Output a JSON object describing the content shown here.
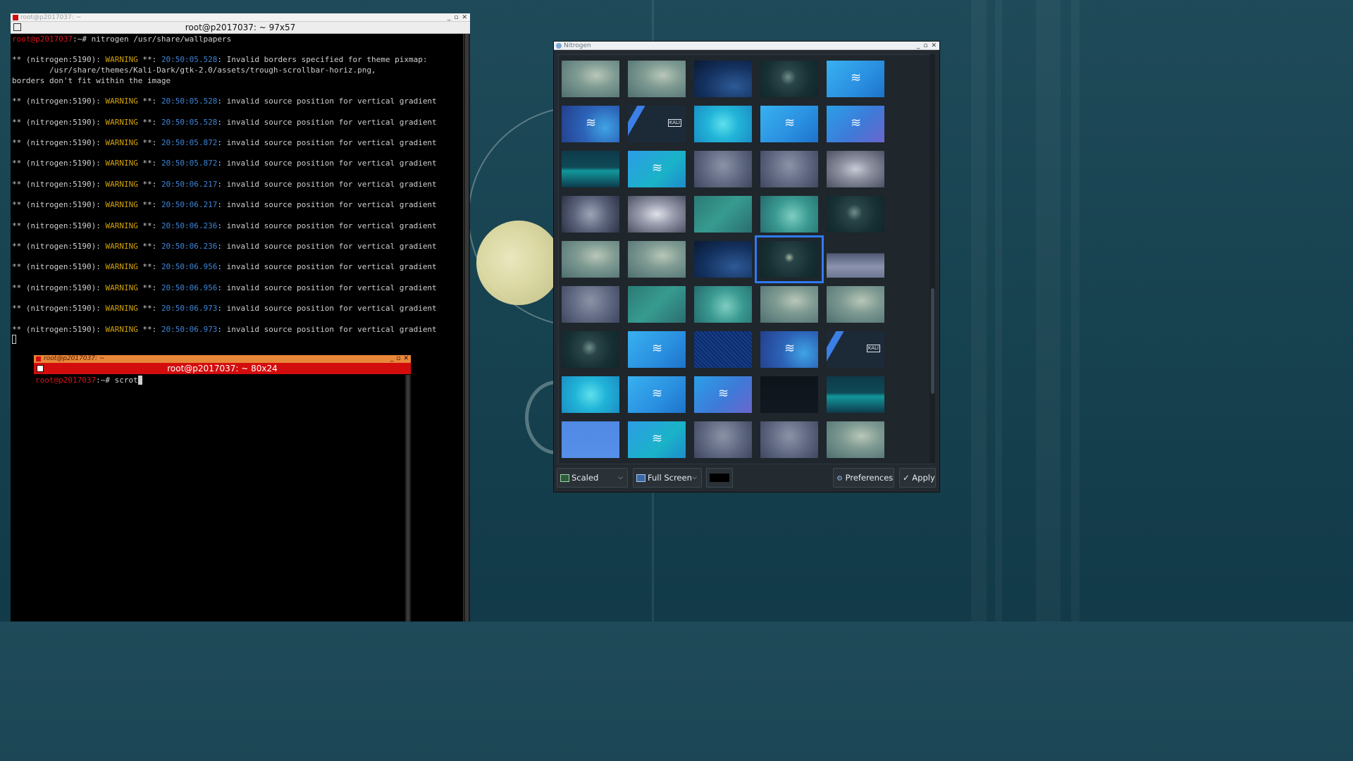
{
  "terminal1": {
    "title": "root@p2017037: ~",
    "header": "root@p2017037: ~ 97x57",
    "prompt_user": "root@p2017037",
    "prompt_path": ":~# ",
    "command": "nitrogen /usr/share/wallpapers",
    "first_warning": {
      "prefix": "** (nitrogen:5190): ",
      "level": "WARNING",
      "stars": " **: ",
      "time": "20:50:05.528",
      "message": ": Invalid borders specified for theme pixmap:",
      "line2": "        /usr/share/themes/Kali-Dark/gtk-2.0/assets/trough-scrollbar-horiz.png,",
      "line3": "borders don't fit within the image"
    },
    "warning_prefix": "** (nitrogen:5190): ",
    "warning_level": "WARNING",
    "warning_stars": " **: ",
    "warning_message": ": invalid source position for vertical gradient",
    "warning_times": [
      "20:50:05.528",
      "20:50:05.528",
      "20:50:05.872",
      "20:50:05.872",
      "20:50:06.217",
      "20:50:06.217",
      "20:50:06.236",
      "20:50:06.236",
      "20:50:06.956",
      "20:50:06.956",
      "20:50:06.973",
      "20:50:06.973"
    ]
  },
  "terminal2": {
    "title": "root@p2017037: ~",
    "header": "root@p2017037: ~ 80x24",
    "prompt_user": "root@p2017037",
    "prompt_path": ":~# ",
    "command": "scrot"
  },
  "nitrogen": {
    "title": "Nitrogen",
    "mode_select": "Scaled",
    "screen_select": "Full Screen",
    "bg_color": "#000000",
    "preferences_label": "Preferences",
    "apply_label": "Apply",
    "kali_badge": "KALI",
    "thumbnails": [
      "swirl-teal",
      "swirl-teal",
      "blue-night",
      "dark-moon",
      "bright-blue-dragon",
      "blue-dragon",
      "kali-stripes",
      "cyan-dot",
      "bright-blue-dragon",
      "blue-mosaic-dragon",
      "geometric-teal",
      "cyan-dragon",
      "gray-swirl",
      "gray-swirl",
      "gray-spot",
      "gray-splash",
      "gray-oval",
      "teal-plain",
      "teal-swirl",
      "dark-moon",
      "swirl-teal",
      "swirl-teal",
      "blue-night",
      "dark-moon-selected",
      "gray-wave",
      "gray-swirl",
      "teal-plain",
      "teal-swirl",
      "swirl-teal",
      "swirl-teal",
      "dark-moon",
      "bright-blue-dragon",
      "blue-noise",
      "blue-dragon",
      "kali-stripes",
      "cyan-dot",
      "bright-blue-dragon",
      "blue-mosaic-dragon",
      "dark-kali-text",
      "geometric-teal",
      "plain-blue",
      "cyan-dragon",
      "gray-swirl",
      "gray-swirl",
      "swirl-teal",
      "swirl-teal",
      "dark-moon",
      "bright-blue-dragon",
      "blue-dragon",
      "kali-stripes"
    ],
    "selected_index": 23
  }
}
